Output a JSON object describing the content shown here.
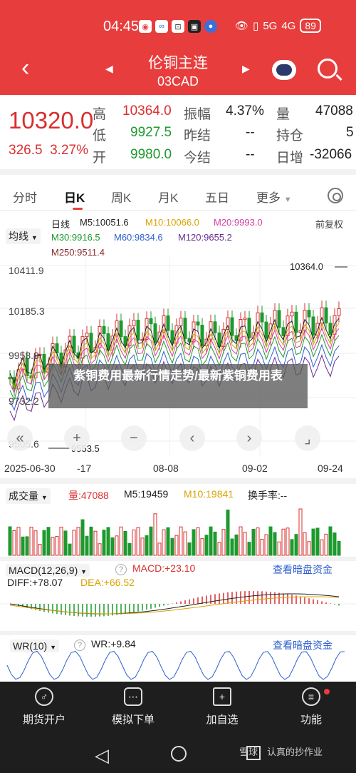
{
  "status_bar": {
    "time": "04:45",
    "signal": "5G",
    "signal2": "4G",
    "battery": "89"
  },
  "nav": {
    "title": "伦铜主连",
    "code": "03CAD"
  },
  "quote": {
    "price": "10320.0",
    "change": "326.5",
    "change_pct": "3.27%",
    "high_label": "高",
    "high": "10364.0",
    "low_label": "低",
    "low": "9927.5",
    "open_label": "开",
    "open": "9980.0",
    "amp_label": "振幅",
    "amp": "4.37%",
    "prev_settle_label": "昨结",
    "prev_settle": "--",
    "settle_label": "今结",
    "settle": "--",
    "vol_label": "量",
    "vol": "47088",
    "oi_label": "持仓",
    "oi": "5",
    "daily_label": "日增",
    "daily": "-32066"
  },
  "tabs": [
    "分时",
    "日K",
    "周K",
    "月K",
    "五日",
    "更多"
  ],
  "ma_legend": {
    "selector": "均线",
    "type": "日线",
    "m5": "M5:10051.6",
    "m10": "M10:10066.0",
    "m20": "M20:9993.0",
    "adjust": "前复权",
    "m30": "M30:9916.5",
    "m60": "M60:9834.6",
    "m120": "M120:9655.2",
    "m250": "M250:9511.4"
  },
  "kline": {
    "y_top": "10411.9",
    "y_mid": "10185.3",
    "y_3": "9958.8",
    "y_4": "9732.2",
    "y_bot": "9505.6",
    "high_mark": "10364.0",
    "low_mark": "9553.5",
    "dates": [
      "2025-06-30",
      "-17",
      "08-08",
      "09-02",
      "09-24"
    ]
  },
  "overlay_text": "紫铜费用最新行情走势/最新紫铜费用表",
  "volume": {
    "selector": "成交量",
    "vol": "量:47088",
    "m5": "M5:19459",
    "m10": "M10:19841",
    "turnover": "换手率:--"
  },
  "macd": {
    "selector": "MACD(12,26,9)",
    "macd": "MACD:+23.10",
    "dif": "DIFF:+78.07",
    "dea": "DEA:+66.52",
    "link": "查看暗盘资金"
  },
  "wr": {
    "selector": "WR(10)",
    "value": "WR:+9.84",
    "link": "查看暗盘资金"
  },
  "bottom_nav": [
    "期货开户",
    "模拟下单",
    "加自选",
    "功能"
  ],
  "watermark": "雪球：认真的抄作业",
  "colors": {
    "header": "#e83d3d",
    "up": "#d92f2f",
    "down": "#1d9a2e"
  }
}
